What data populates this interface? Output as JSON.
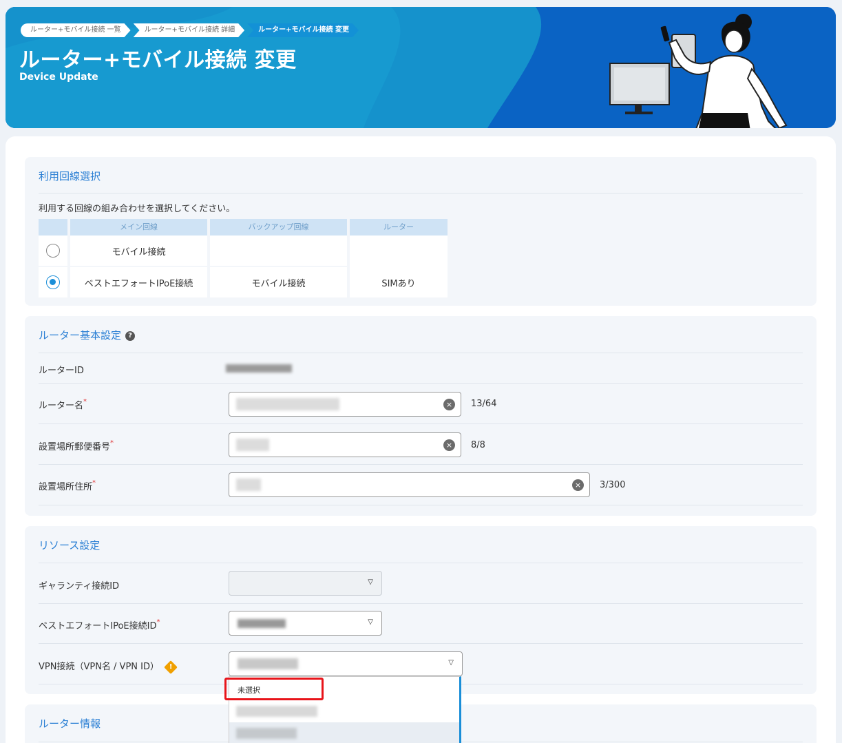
{
  "header": {
    "breadcrumbs": [
      "ルーター+モバイル接続 一覧",
      "ルーター+モバイル接続 詳細",
      "ルーター+モバイル接続 変更"
    ],
    "title": "ルーター+モバイル接続 変更",
    "subtitle": "Device Update"
  },
  "line_selection": {
    "title": "利用回線選択",
    "description": "利用する回線の組み合わせを選択してください。",
    "columns": [
      "メイン回線",
      "バックアップ回線",
      "ルーター"
    ],
    "rows": [
      {
        "main": "モバイル接続",
        "backup": "",
        "router": "",
        "selected": false
      },
      {
        "main": "ベストエフォートIPoE接続",
        "backup": "モバイル接続",
        "router": "SIMあり",
        "selected": true
      }
    ]
  },
  "router_basic": {
    "title": "ルーター基本設定",
    "router_id_label": "ルーターID",
    "router_name_label": "ルーター名",
    "router_name_count": "13/64",
    "postal_label": "設置場所郵便番号",
    "postal_count": "8/8",
    "address_label": "設置場所住所",
    "address_count": "3/300",
    "required_mark": "*",
    "clear_symbol": "×"
  },
  "resource": {
    "title": "リソース設定",
    "guarantee_label": "ギャランティ接続ID",
    "best_effort_label": "ベストエフォートIPoE接続ID",
    "vpn_label": "VPN接続（VPN名 / VPN ID）",
    "arrow_symbol": "▽",
    "dropdown_first_option": "未選択"
  },
  "router_info": {
    "title": "ルーター情報"
  },
  "colors": {
    "accent": "#2a7fd4",
    "hero_blue": "#0a63c4",
    "highlight": "#e8141a",
    "warning": "#f0a000"
  }
}
